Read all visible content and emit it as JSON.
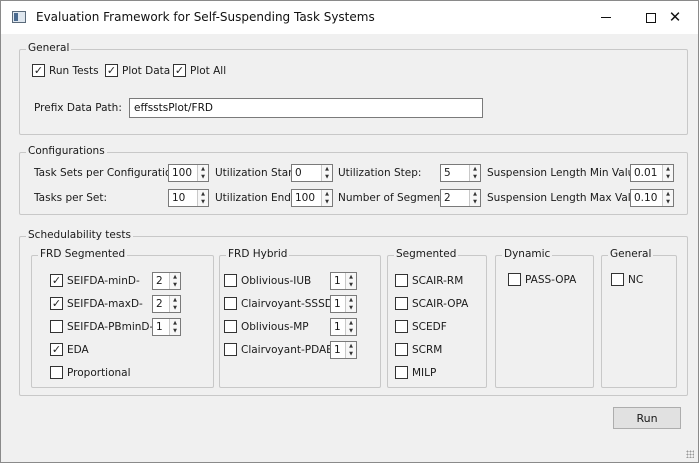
{
  "window": {
    "title": "Evaluation Framework for Self-Suspending Task Systems",
    "minimize_glyph": "",
    "close_glyph": "✕"
  },
  "general": {
    "title": "General",
    "run_tests": {
      "label": "Run Tests",
      "checked": true
    },
    "plot_data": {
      "label": "Plot Data",
      "checked": true
    },
    "plot_all": {
      "label": "Plot All",
      "checked": true
    },
    "prefix_label": "Prefix Data Path:",
    "prefix_value": "effsstsPlot/FRD"
  },
  "configurations": {
    "title": "Configurations",
    "task_sets_label": "Task Sets per Configuration:",
    "task_sets_value": "100",
    "tasks_per_set_label": "Tasks per Set:",
    "tasks_per_set_value": "10",
    "util_start_label": "Utilization Start:",
    "util_start_value": "0",
    "util_end_label": "Utilization End:",
    "util_end_value": "100",
    "util_step_label": "Utilization Step:",
    "util_step_value": "5",
    "num_segments_label": "Number of Segments:",
    "num_segments_value": "2",
    "susp_min_label": "Suspension Length Min Value:",
    "susp_min_value": "0.01",
    "susp_max_label": "Suspension Length Max Value:",
    "susp_max_value": "0.10"
  },
  "schedulability": {
    "title": "Schedulability tests",
    "frd_segmented": {
      "title": "FRD Segmented",
      "items": [
        {
          "label": "SEIFDA-minD-",
          "checked": true,
          "value": "2"
        },
        {
          "label": "SEIFDA-maxD-",
          "checked": true,
          "value": "2"
        },
        {
          "label": "SEIFDA-PBminD-",
          "checked": false,
          "value": "1"
        },
        {
          "label": "EDA",
          "checked": true
        },
        {
          "label": "Proportional",
          "checked": false
        }
      ]
    },
    "frd_hybrid": {
      "title": "FRD Hybrid",
      "items": [
        {
          "label": "Oblivious-IUB",
          "checked": false,
          "value": "1"
        },
        {
          "label": "Clairvoyant-SSSD",
          "checked": false,
          "value": "1"
        },
        {
          "label": "Oblivious-MP",
          "checked": false,
          "value": "1"
        },
        {
          "label": "Clairvoyant-PDAB",
          "checked": false,
          "value": "1"
        }
      ]
    },
    "segmented": {
      "title": "Segmented",
      "items": [
        {
          "label": "SCAIR-RM",
          "checked": false
        },
        {
          "label": "SCAIR-OPA",
          "checked": false
        },
        {
          "label": "SCEDF",
          "checked": false
        },
        {
          "label": "SCRM",
          "checked": false
        },
        {
          "label": "MILP",
          "checked": false
        }
      ]
    },
    "dynamic": {
      "title": "Dynamic",
      "items": [
        {
          "label": "PASS-OPA",
          "checked": false
        }
      ]
    },
    "general2": {
      "title": "General",
      "items": [
        {
          "label": "NC",
          "checked": false
        }
      ]
    }
  },
  "run_label": "Run",
  "spin_up": "▲",
  "spin_down": "▼"
}
